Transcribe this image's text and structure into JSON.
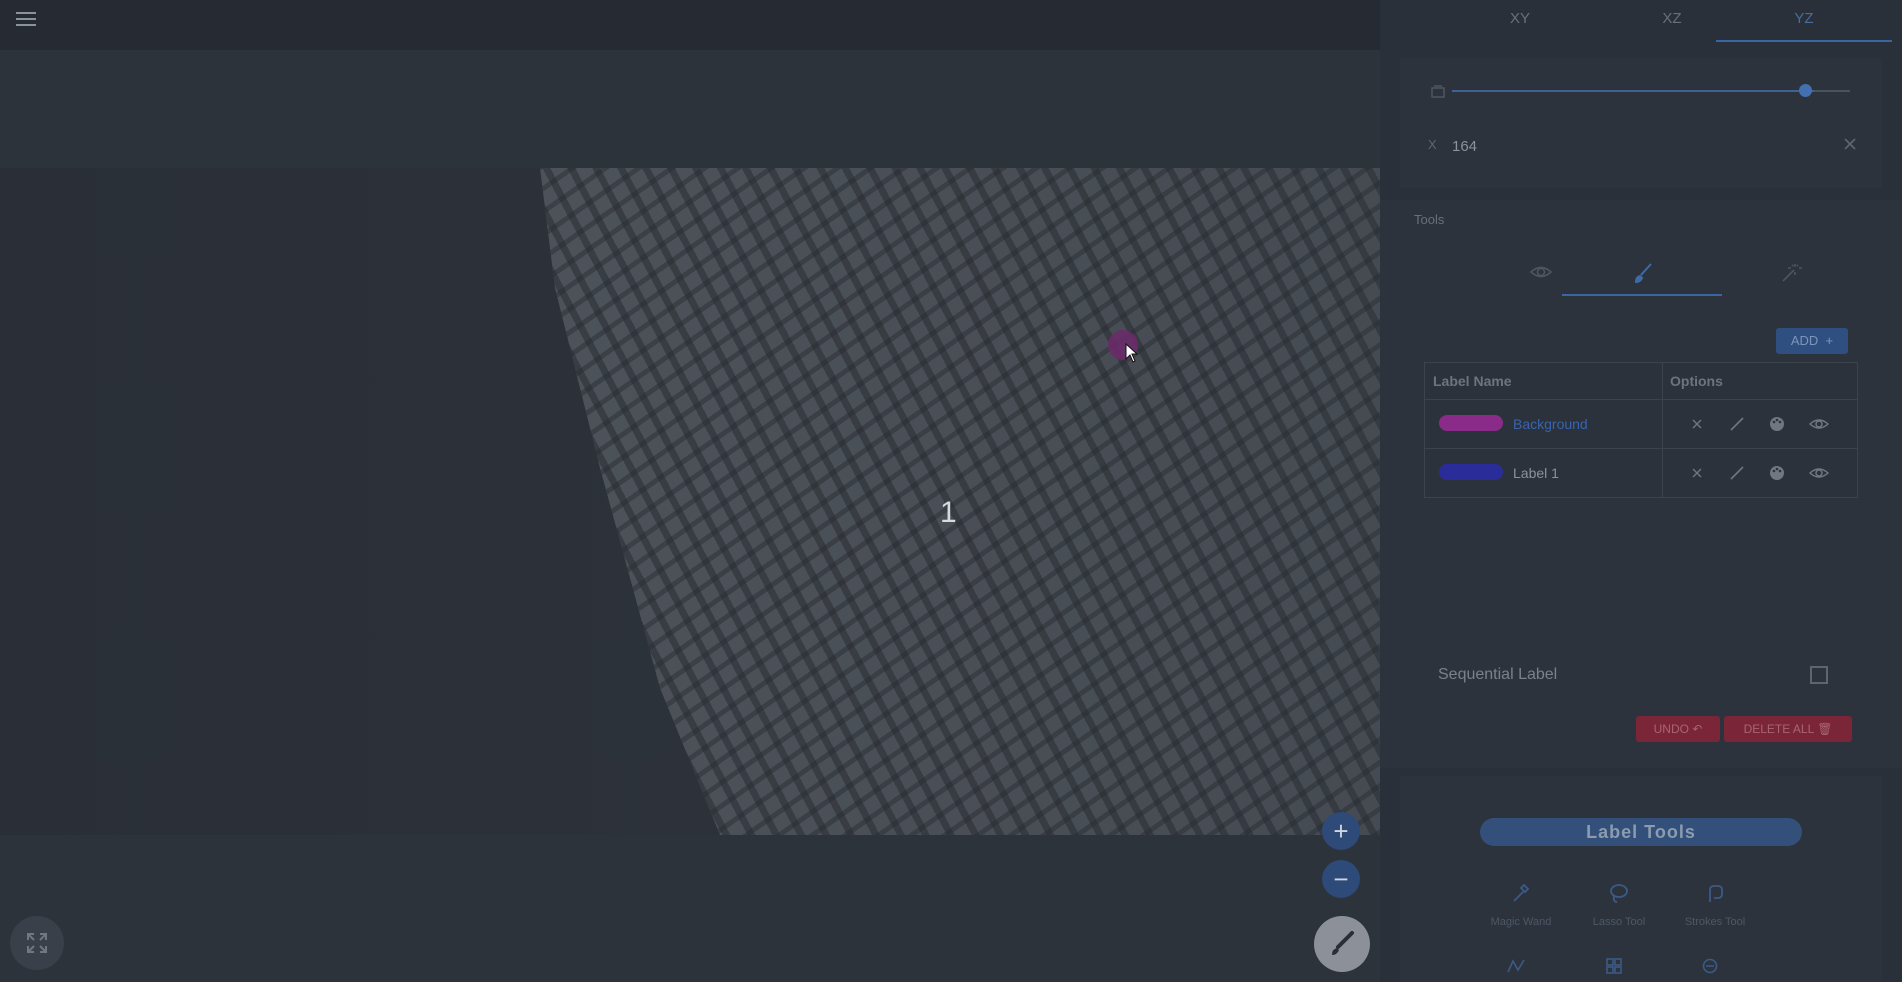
{
  "viewer": {
    "slice_number_label": "1",
    "menu_icon": "hamburger-menu-icon",
    "zoom_in_symbol": "+",
    "zoom_out_symbol": "−",
    "brush_cursor_color": "#6d2a6b"
  },
  "tabs": [
    {
      "label": "XY",
      "active": false
    },
    {
      "label": "XZ",
      "active": false
    },
    {
      "label": "YZ",
      "active": true
    }
  ],
  "slice": {
    "axis_letter": "X",
    "value": "164",
    "slider_position_fraction": 0.89
  },
  "tools": {
    "title": "Tools",
    "tabs": [
      "eye-icon",
      "brush-icon",
      "magic-wand-icon"
    ],
    "active_tab": "brush-icon",
    "add_label": "ADD",
    "table": {
      "headers": [
        "Label Name",
        "Options"
      ],
      "rows": [
        {
          "name": "Background",
          "color": "#8a2b8a",
          "name_color": "#3764b0"
        },
        {
          "name": "Label 1",
          "color": "#2a2c9a",
          "name_color": "#8a929c"
        }
      ]
    },
    "sequential_label": "Sequential Label",
    "sequential_checked": false,
    "undo_label": "UNDO",
    "delete_all_label": "DELETE ALL"
  },
  "label_tools": {
    "title": "Label Tools",
    "items": [
      {
        "label": "Magic Wand"
      },
      {
        "label": "Lasso Tool"
      },
      {
        "label": "Strokes Tool"
      }
    ]
  },
  "colors": {
    "accent": "#3a64a4",
    "danger": "#7a2638"
  }
}
